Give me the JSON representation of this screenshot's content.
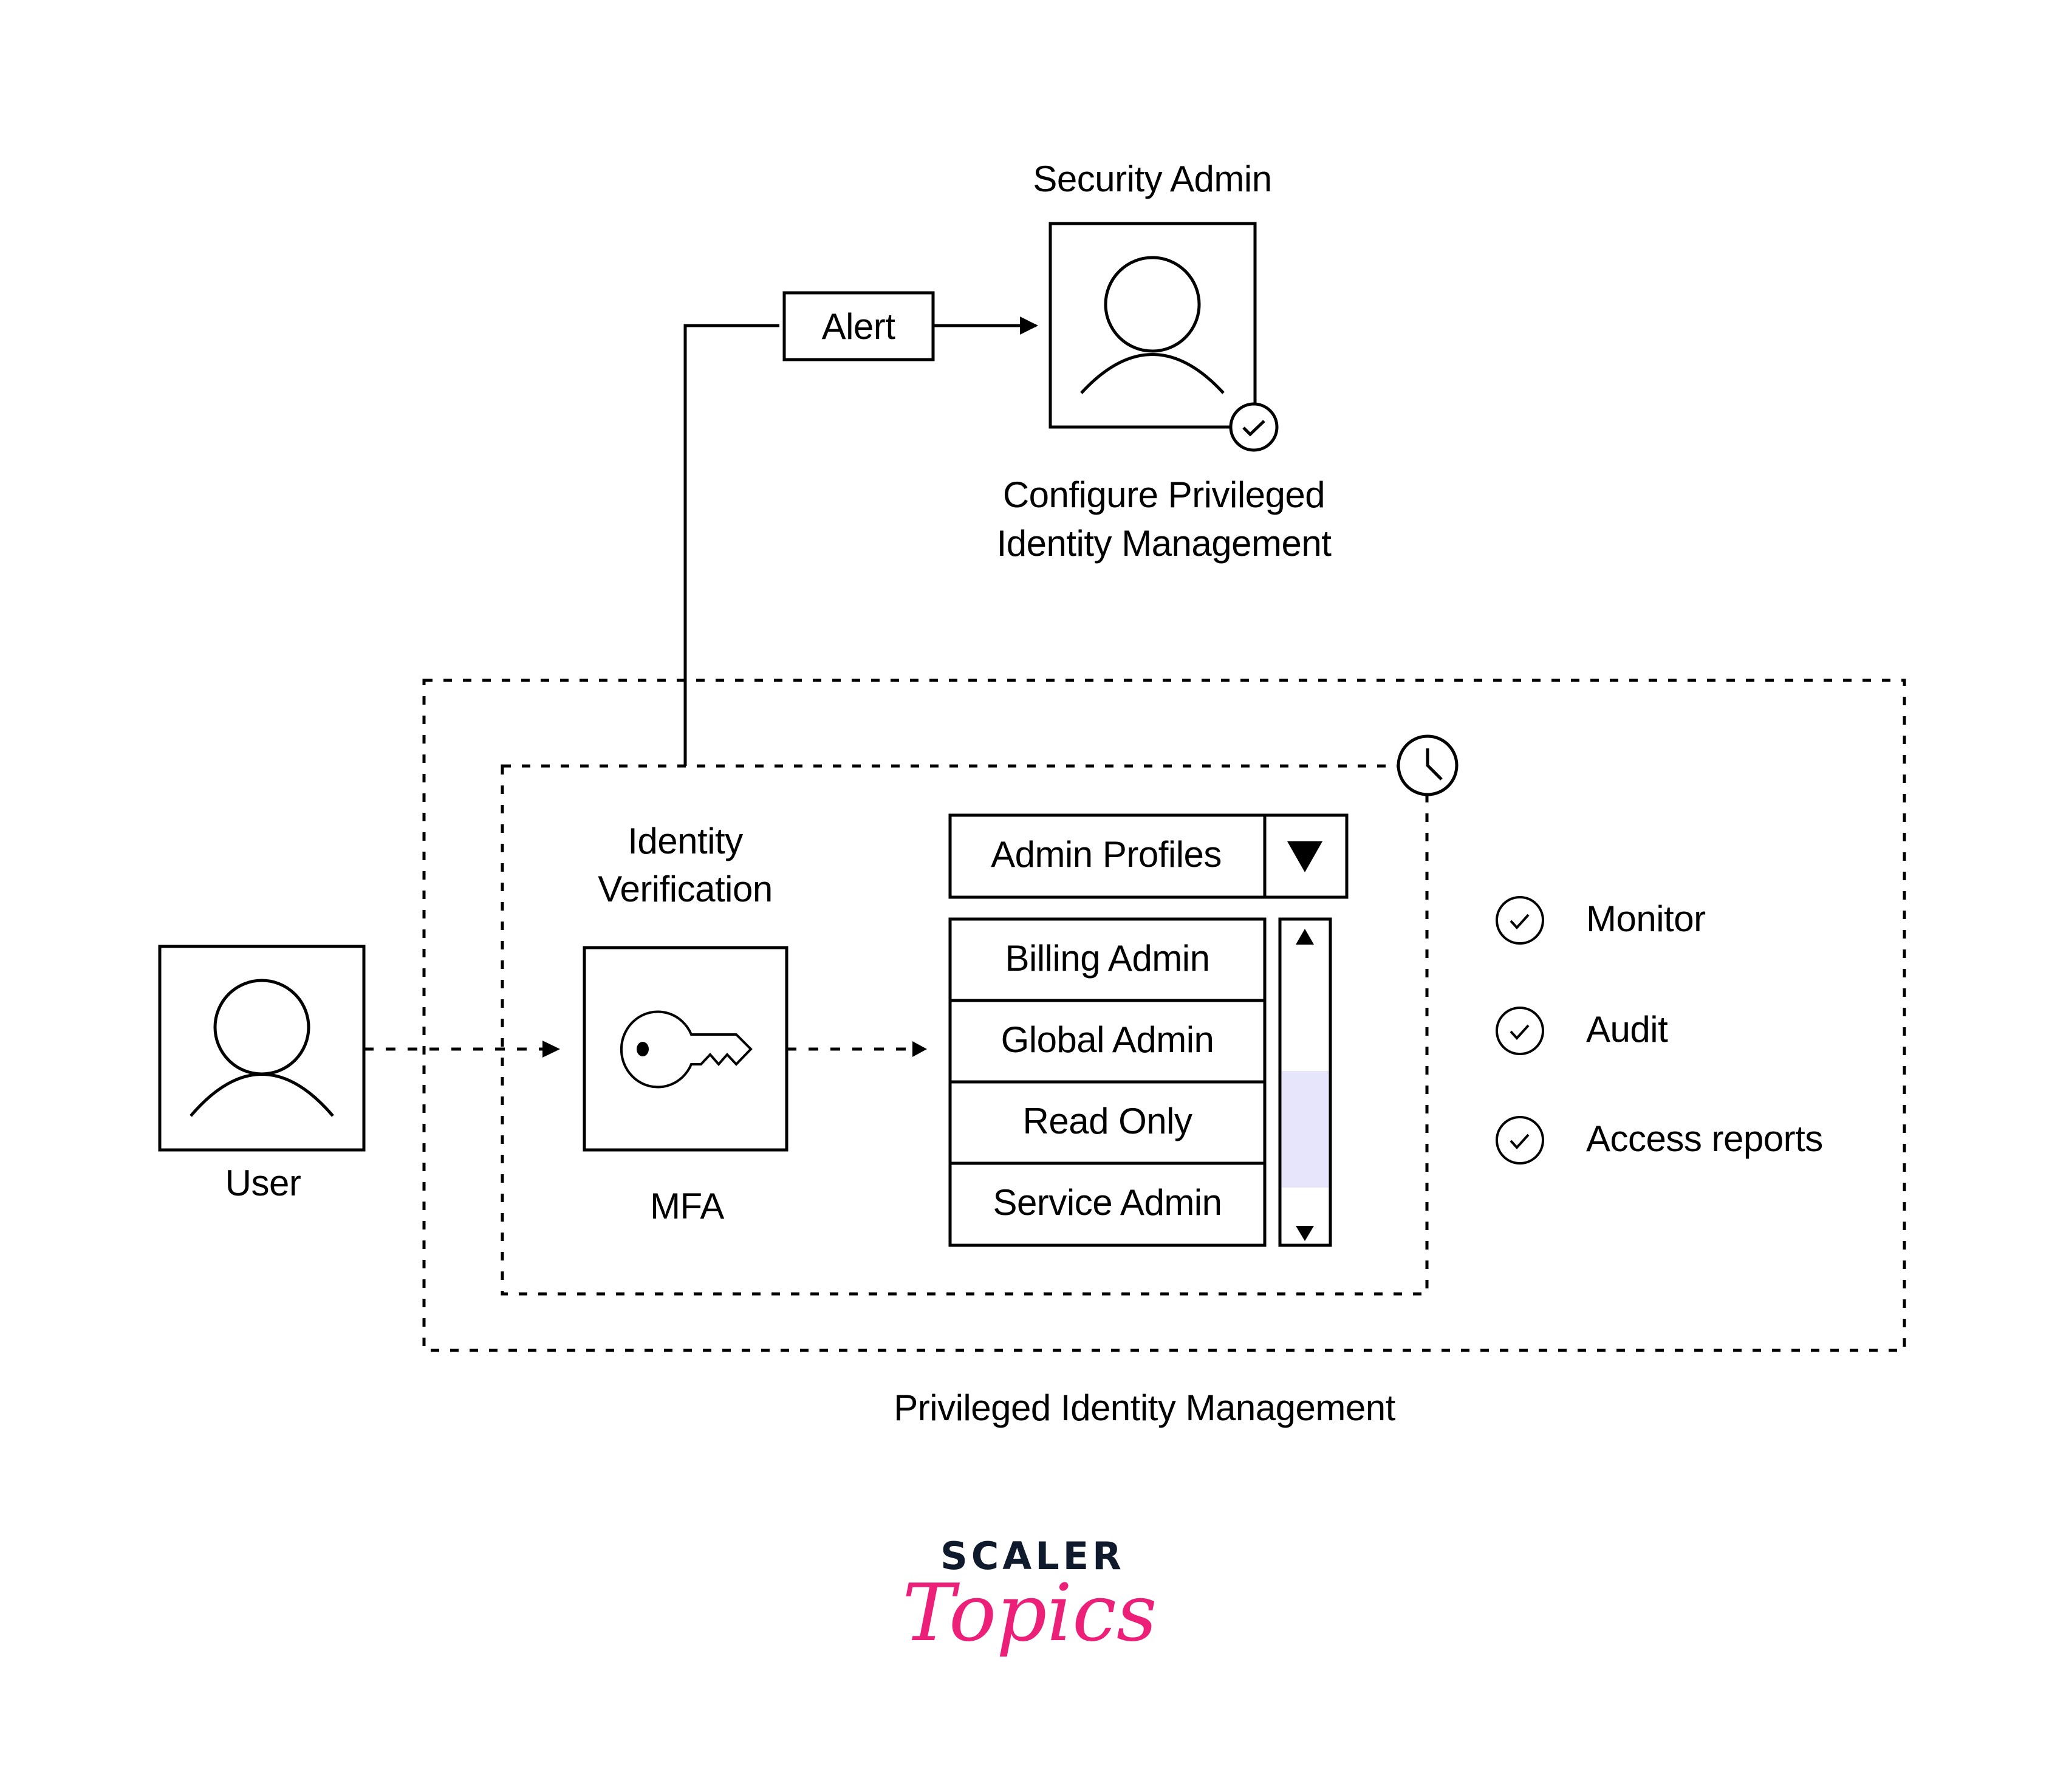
{
  "colors": {
    "outer_zone_fill": "#fde6e9",
    "user_box_fill": "#fde6e9",
    "alert_fill": "#fde6e9",
    "security_admin_fill": "#e6e5fb",
    "selected_row_fill": "#e2fcfb",
    "scroll_thumb_fill": "#e6e5fb",
    "brand_dark": "#0f1a2c",
    "brand_pink": "#ec1f79"
  },
  "security_admin": {
    "title": "Security Admin",
    "icon": "user-avatar-icon",
    "badge_icon": "check-circle-icon",
    "caption_line1": "Configure Privileged",
    "caption_line2": "Identity Management"
  },
  "alert": {
    "label": "Alert"
  },
  "user": {
    "label": "User",
    "icon": "user-avatar-icon"
  },
  "identity_verification": {
    "title_line1": "Identity",
    "title_line2": "Verification",
    "mfa_label": "MFA",
    "icon": "key-icon"
  },
  "admin_profiles": {
    "dropdown_label": "Admin Profiles",
    "dropdown_icon": "triangle-down-icon",
    "options": [
      {
        "label": "Billing Admin",
        "selected": false
      },
      {
        "label": "Global Admin",
        "selected": false
      },
      {
        "label": "Read Only",
        "selected": true
      },
      {
        "label": "Service Admin",
        "selected": false
      }
    ],
    "scroll_up_icon": "scroll-up-icon",
    "scroll_down_icon": "scroll-down-icon"
  },
  "timer_icon": "clock-icon",
  "features": [
    {
      "label": "Monitor",
      "icon": "check-circle-icon"
    },
    {
      "label": "Audit",
      "icon": "check-circle-icon"
    },
    {
      "label": "Access reports",
      "icon": "check-circle-icon"
    }
  ],
  "zone_caption": "Privileged Identity Management",
  "brand": {
    "line1": "SCALER",
    "line2": "Topics"
  }
}
